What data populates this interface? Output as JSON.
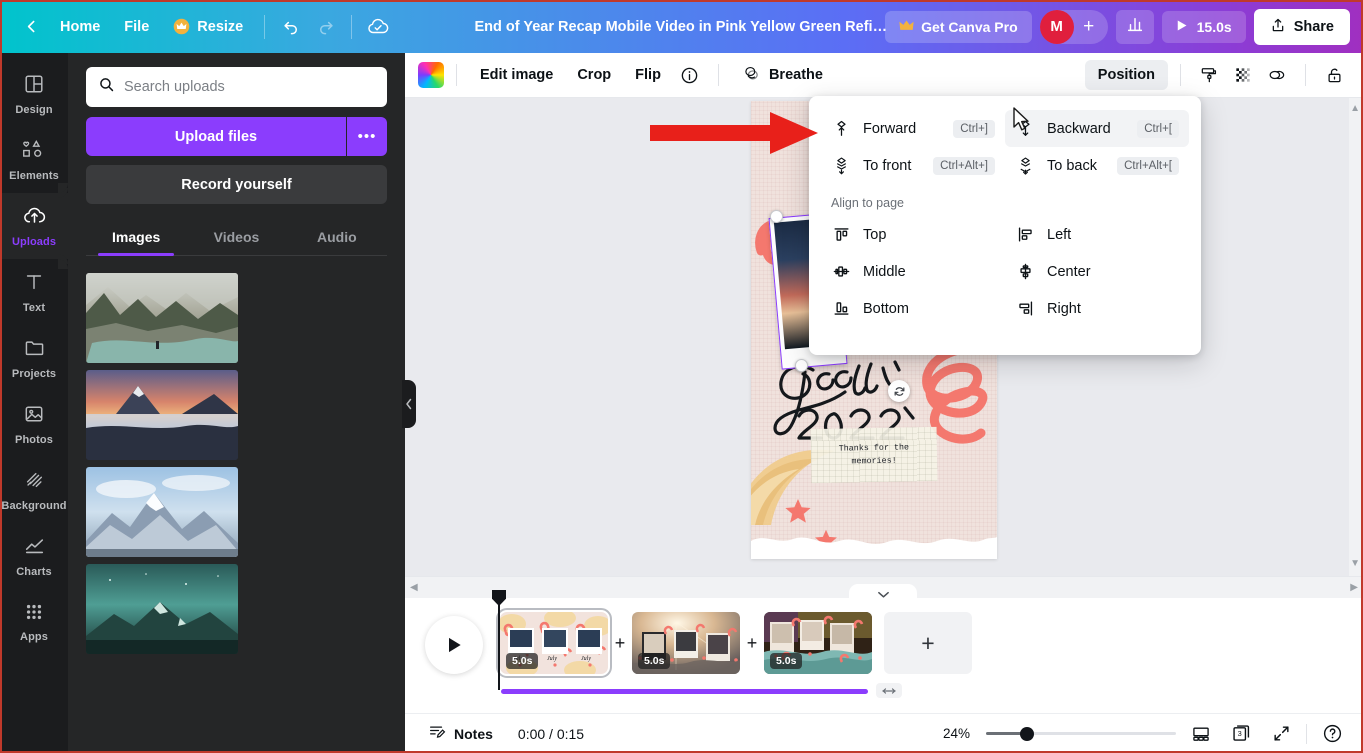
{
  "topbar": {
    "back_label": "",
    "home_label": "Home",
    "file_label": "File",
    "resize_label": "Resize",
    "title": "End of Year Recap Mobile Video in Pink Yellow Green Refine…",
    "get_pro_label": "Get Canva Pro",
    "avatar_initial": "M",
    "add_collaborator_label": "+",
    "duration_label": "15.0s",
    "share_label": "Share"
  },
  "rail": {
    "items": [
      {
        "label": "Design",
        "icon": "design-icon",
        "active": false
      },
      {
        "label": "Elements",
        "icon": "elements-icon",
        "active": false
      },
      {
        "label": "Uploads",
        "icon": "uploads-icon",
        "active": true
      },
      {
        "label": "Text",
        "icon": "text-icon",
        "active": false
      },
      {
        "label": "Projects",
        "icon": "projects-icon",
        "active": false
      },
      {
        "label": "Photos",
        "icon": "photos-icon",
        "active": false
      },
      {
        "label": "Background",
        "icon": "background-icon",
        "active": false
      },
      {
        "label": "Charts",
        "icon": "charts-icon",
        "active": false
      },
      {
        "label": "Apps",
        "icon": "apps-icon",
        "active": false
      }
    ]
  },
  "panel": {
    "search_placeholder": "Search uploads",
    "search_value": "",
    "upload_files_label": "Upload files",
    "upload_more_label": "•••",
    "record_label": "Record yourself",
    "tabs": [
      {
        "label": "Images",
        "active": true
      },
      {
        "label": "Videos",
        "active": false
      },
      {
        "label": "Audio",
        "active": false
      }
    ],
    "thumbnails": [
      {
        "name": "misty-forest-river"
      },
      {
        "name": "sunset-mountain-clouds"
      },
      {
        "name": "snowy-mountain-peaks"
      },
      {
        "name": "teal-night-mountains"
      }
    ]
  },
  "editor_toolbar": {
    "color_swatch_label": "",
    "edit_image_label": "Edit image",
    "crop_label": "Crop",
    "flip_label": "Flip",
    "info_label": "",
    "breathe_label": "Breathe",
    "position_label": "Position"
  },
  "position_menu": {
    "layers": [
      {
        "label": "Forward",
        "shortcut": "Ctrl+]",
        "icon": "forward-icon",
        "hovered": false
      },
      {
        "label": "Backward",
        "shortcut": "Ctrl+[",
        "icon": "backward-icon",
        "hovered": true
      },
      {
        "label": "To front",
        "shortcut": "Ctrl+Alt+]",
        "icon": "to-front-icon",
        "hovered": false
      },
      {
        "label": "To back",
        "shortcut": "Ctrl+Alt+[",
        "icon": "to-back-icon",
        "hovered": false
      }
    ],
    "align_heading": "Align to page",
    "align": [
      {
        "label": "Top",
        "icon": "align-top-icon"
      },
      {
        "label": "Left",
        "icon": "align-left-icon"
      },
      {
        "label": "Middle",
        "icon": "align-middle-icon"
      },
      {
        "label": "Center",
        "icon": "align-center-icon"
      },
      {
        "label": "Bottom",
        "icon": "align-bottom-icon"
      },
      {
        "label": "Right",
        "icon": "align-right-icon"
      }
    ]
  },
  "canvas": {
    "design_title_line1": "Goodbye,",
    "design_title_line2": "2022",
    "note_text": "Thanks for the memories!"
  },
  "timeline": {
    "scenes": [
      {
        "duration": "5.0s",
        "selected": true,
        "name": "scene-1-pink-collage"
      },
      {
        "duration": "5.0s",
        "selected": false,
        "name": "scene-2-sunburst-polaroids"
      },
      {
        "duration": "5.0s",
        "selected": false,
        "name": "scene-3-dark-collage"
      }
    ],
    "add_scene_label": "+",
    "add_page_label": "+"
  },
  "bottombar": {
    "notes_label": "Notes",
    "timecode": "0:00 / 0:15",
    "zoom_percent": "24%",
    "page_count": "3"
  },
  "colors": {
    "brand_purple": "#8b3dfd",
    "accent_red": "#e01f3d",
    "panel_dark": "#252627",
    "rail_dark": "#1b1c1e",
    "canvas_bg": "#e9eaee"
  }
}
